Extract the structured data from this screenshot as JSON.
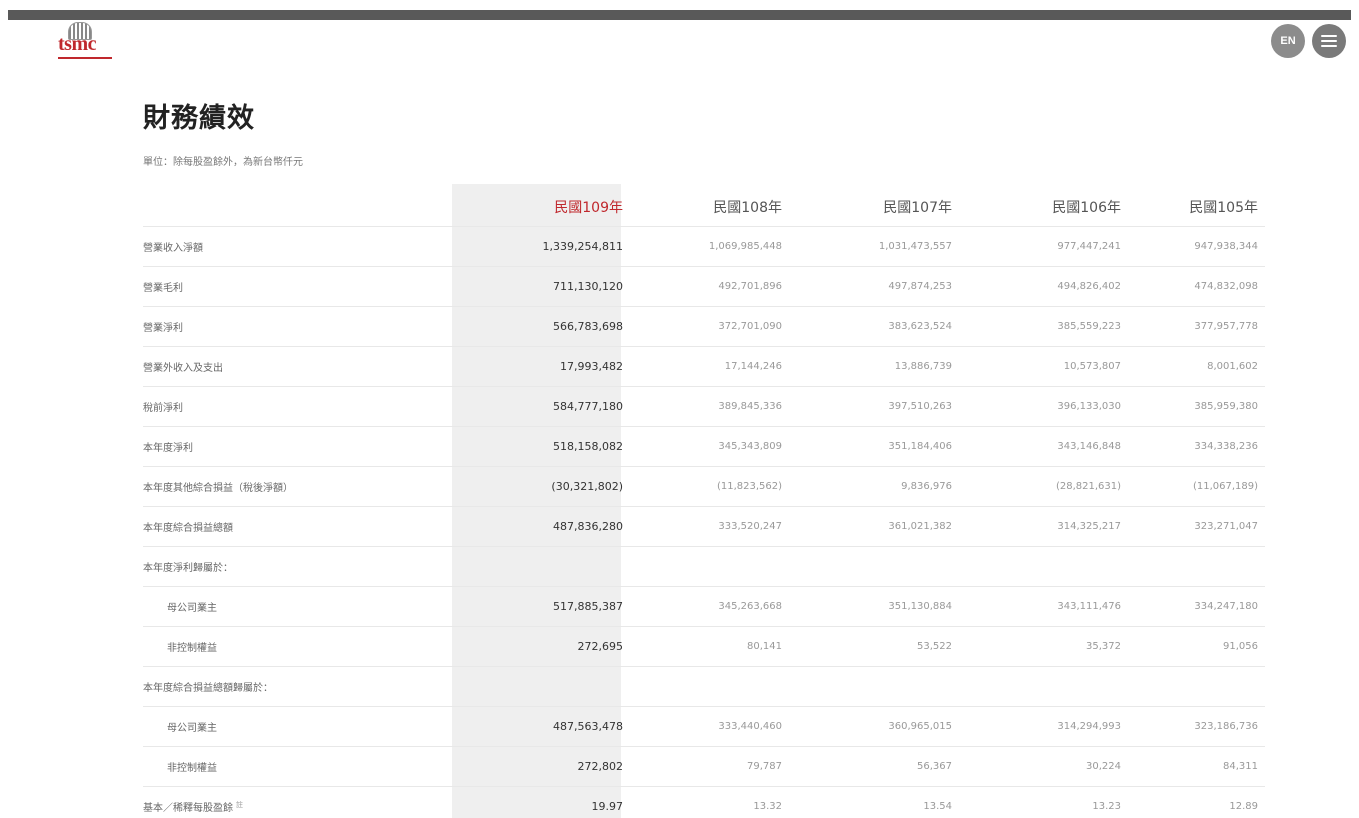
{
  "header": {
    "logo_text": "tsmc",
    "lang_label": "EN"
  },
  "page": {
    "title": "財務績效",
    "unit_note": "單位：除每股盈餘外，為新台幣仟元"
  },
  "table": {
    "columns": [
      "民國109年",
      "民國108年",
      "民國107年",
      "民國106年",
      "民國105年"
    ],
    "rows": [
      {
        "label": "營業收入淨額",
        "values": [
          "1,339,254,811",
          "1,069,985,448",
          "1,031,473,557",
          "977,447,241",
          "947,938,344"
        ]
      },
      {
        "label": "營業毛利",
        "values": [
          "711,130,120",
          "492,701,896",
          "497,874,253",
          "494,826,402",
          "474,832,098"
        ]
      },
      {
        "label": "營業淨利",
        "values": [
          "566,783,698",
          "372,701,090",
          "383,623,524",
          "385,559,223",
          "377,957,778"
        ]
      },
      {
        "label": "營業外收入及支出",
        "values": [
          "17,993,482",
          "17,144,246",
          "13,886,739",
          "10,573,807",
          "8,001,602"
        ]
      },
      {
        "label": "稅前淨利",
        "values": [
          "584,777,180",
          "389,845,336",
          "397,510,263",
          "396,133,030",
          "385,959,380"
        ]
      },
      {
        "label": "本年度淨利",
        "values": [
          "518,158,082",
          "345,343,809",
          "351,184,406",
          "343,146,848",
          "334,338,236"
        ]
      },
      {
        "label": "本年度其他綜合損益（稅後淨額）",
        "values": [
          "(30,321,802)",
          "(11,823,562)",
          "9,836,976",
          "(28,821,631)",
          "(11,067,189)"
        ]
      },
      {
        "label": "本年度綜合損益總額",
        "values": [
          "487,836,280",
          "333,520,247",
          "361,021,382",
          "314,325,217",
          "323,271,047"
        ]
      },
      {
        "label": "本年度淨利歸屬於：",
        "values": [
          "",
          "",
          "",
          "",
          ""
        ]
      },
      {
        "label": "母公司業主",
        "values": [
          "517,885,387",
          "345,263,668",
          "351,130,884",
          "343,111,476",
          "334,247,180"
        ],
        "indent": true
      },
      {
        "label": "非控制權益",
        "values": [
          "272,695",
          "80,141",
          "53,522",
          "35,372",
          "91,056"
        ],
        "indent": true
      },
      {
        "label": "本年度綜合損益總額歸屬於：",
        "values": [
          "",
          "",
          "",
          "",
          ""
        ]
      },
      {
        "label": "母公司業主",
        "values": [
          "487,563,478",
          "333,440,460",
          "360,965,015",
          "314,294,993",
          "323,186,736"
        ],
        "indent": true
      },
      {
        "label": "非控制權益",
        "values": [
          "272,802",
          "79,787",
          "56,367",
          "30,224",
          "84,311"
        ],
        "indent": true
      },
      {
        "label": "基本／稀釋每股盈餘",
        "values": [
          "19.97",
          "13.32",
          "13.54",
          "13.23",
          "12.89"
        ],
        "footnote": "註"
      }
    ]
  }
}
